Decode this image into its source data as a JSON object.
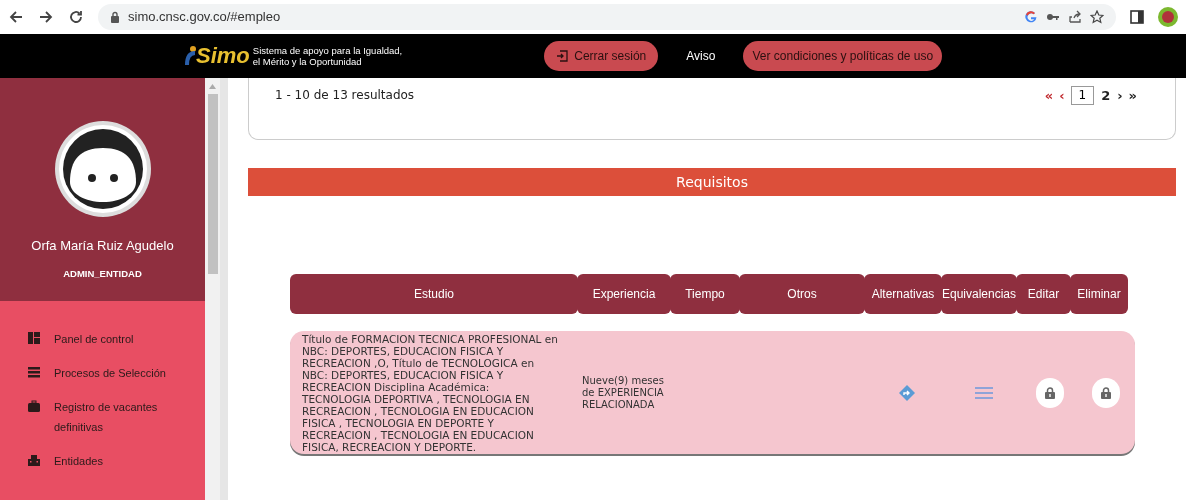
{
  "browser": {
    "url": "simo.cnsc.gov.co/#empleo"
  },
  "header": {
    "logo_text": "Simo",
    "tagline": [
      "Sistema de apoyo para la Igualdad,",
      "el Mérito y la Oportunidad"
    ],
    "logout": "Cerrar sesión",
    "notice": "Aviso",
    "terms": "Ver condiciones y políticas de uso"
  },
  "sidebar": {
    "user_name": "Orfa María Ruiz Agudelo",
    "role": "ADMIN_ENTIDAD",
    "items": [
      {
        "kind": "dashboard",
        "label": "Panel de control"
      },
      {
        "kind": "list",
        "label": "Procesos de Selección"
      },
      {
        "kind": "briefcase",
        "label": "Registro de vacantes definitivas"
      },
      {
        "kind": "building",
        "label": "Entidades"
      }
    ]
  },
  "results": {
    "summary": "1 - 10 de 13 resultados",
    "first": "«",
    "prev": "‹",
    "pages": [
      {
        "label": "1",
        "selected": true
      },
      {
        "label": "2",
        "selected": false
      }
    ],
    "next": "›",
    "last": "»"
  },
  "requisitos": {
    "title": "Requisitos",
    "columns": [
      "Estudio",
      "Experiencia",
      "Tiempo",
      "Otros",
      "Alternativas",
      "Equivalencias",
      "Editar",
      "Eliminar"
    ],
    "rows": [
      {
        "estudio": "Título de FORMACION TECNICA PROFESIONAL en NBC: DEPORTES, EDUCACION FISICA Y RECREACION ,O, Título de TECNOLOGICA en NBC: DEPORTES, EDUCACION FISICA Y RECREACION Disciplina Académica: TECNOLOGIA DEPORTIVA , TECNOLOGIA EN RECREACION , TECNOLOGIA EN EDUCACION FISICA , TECNOLOGIA EN DEPORTE Y RECREACION , TECNOLOGIA EN EDUCACION FISICA, RECREACION Y DEPORTE.",
        "experiencia": "Nueve(9) meses de EXPERIENCIA RELACIONADA"
      }
    ]
  }
}
